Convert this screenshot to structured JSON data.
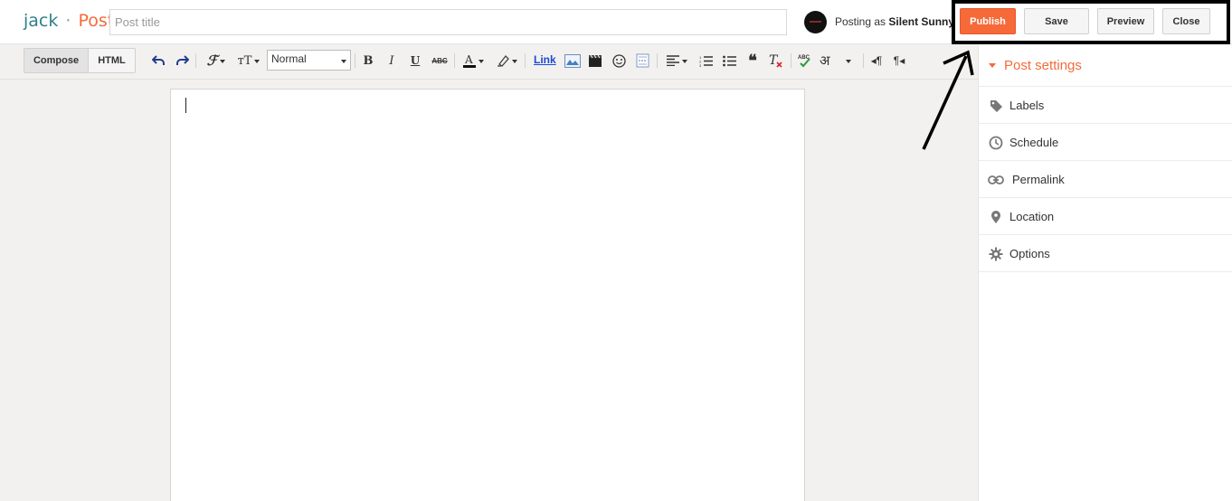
{
  "header": {
    "blog_name": "jack",
    "separator": "·",
    "page_type": "Post",
    "title_placeholder": "Post title",
    "posting_as_prefix": "Posting as",
    "author": "Silent Sunny",
    "actions": {
      "publish": "Publish",
      "save": "Save",
      "preview": "Preview",
      "close": "Close"
    }
  },
  "toolbar": {
    "modes": {
      "compose": "Compose",
      "html": "HTML"
    },
    "format_select": "Normal",
    "link_label": "Link",
    "icons": [
      "undo-icon",
      "redo-icon",
      "font-family-icon",
      "font-size-icon",
      "bold-icon",
      "italic-icon",
      "underline-icon",
      "strikethrough-icon",
      "text-color-icon",
      "highlight-icon",
      "link-icon",
      "image-icon",
      "video-icon",
      "emoji-icon",
      "jump-break-icon",
      "align-icon",
      "numbered-list-icon",
      "bullet-list-icon",
      "quote-icon",
      "clear-formatting-icon",
      "spellcheck-icon",
      "transliterate-icon",
      "ltr-icon",
      "rtl-icon"
    ]
  },
  "sidebar": {
    "title": "Post settings",
    "items": [
      {
        "label": "Labels",
        "icon": "tag-icon"
      },
      {
        "label": "Schedule",
        "icon": "clock-icon"
      },
      {
        "label": "Permalink",
        "icon": "link-chain-icon"
      },
      {
        "label": "Location",
        "icon": "map-pin-icon"
      },
      {
        "label": "Options",
        "icon": "gear-icon"
      }
    ]
  },
  "colors": {
    "accent": "#f46b3b",
    "publish_bg": "#f66a3a",
    "blog_name": "#2f7f8a"
  }
}
